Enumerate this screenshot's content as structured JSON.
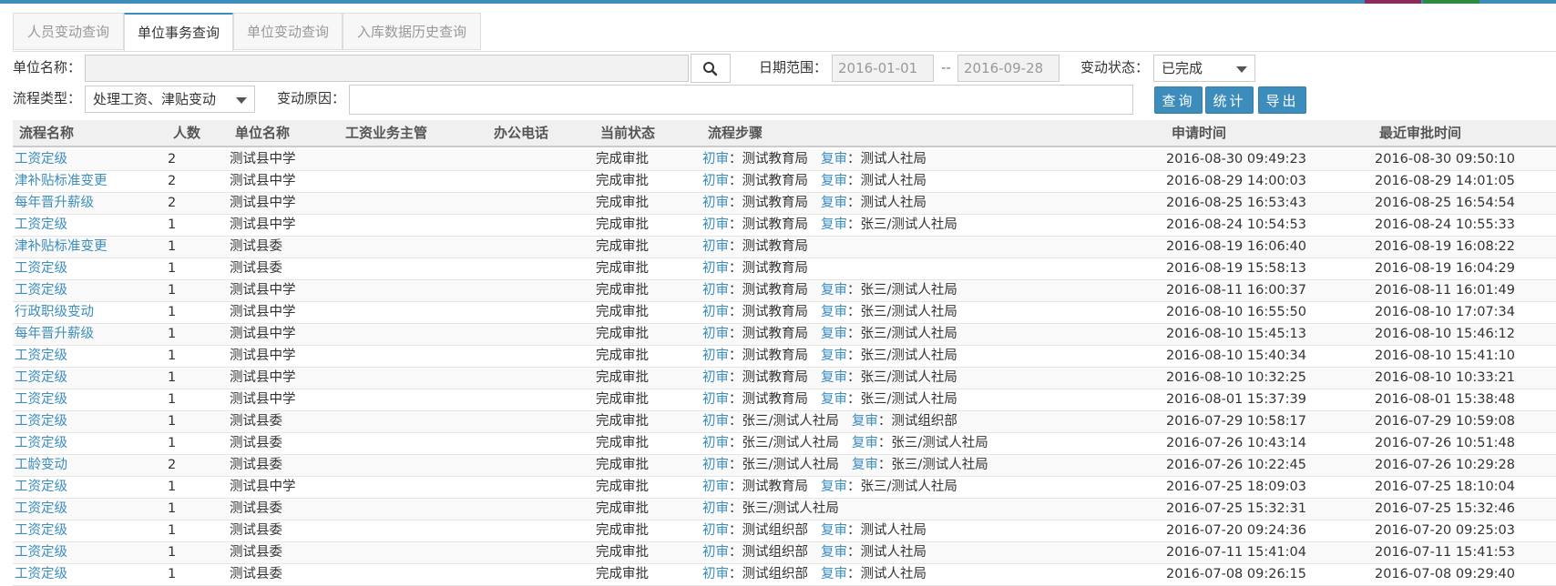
{
  "tabs": [
    "人员变动查询",
    "单位事务查询",
    "单位变动查询",
    "入库数据历史查询"
  ],
  "active_tab": 1,
  "filters": {
    "unit_name_label": "单位名称：",
    "unit_name_value": "",
    "date_range_label": "日期范围：",
    "date_from": "2016-01-01",
    "date_sep": "--",
    "date_to": "2016-09-28",
    "status_label": "变动状态：",
    "status_value": "已完成",
    "flow_type_label": "流程类型：",
    "flow_type_value": "处理工资、津贴变动",
    "reason_label": "变动原因：",
    "reason_value": ""
  },
  "buttons": {
    "query": "查询",
    "stats": "统计",
    "export": "导出"
  },
  "icons": {
    "search": "search-icon",
    "dropdown": "chevron-down-icon"
  },
  "colors": {
    "accent": "#3c8dbc",
    "topbar_segments": [
      "#3c8dbc",
      "#8e2b5d",
      "#2f8b3f"
    ]
  },
  "table": {
    "headers": [
      "流程名称",
      "人数",
      "单位名称",
      "工资业务主管",
      "办公电话",
      "当前状态",
      "流程步骤",
      "申请时间",
      "最近审批时间"
    ],
    "rows": [
      {
        "name": "工资定级",
        "count": "2",
        "unit": "测试县中学",
        "status": "完成审批",
        "step1_tag": "初审",
        "step1": "：测试教育局",
        "step2_tag": "复审",
        "step2": "：测试人社局",
        "apply": "2016-08-30 09:49:23",
        "approve": "2016-08-30 09:50:10"
      },
      {
        "name": "津补贴标准变更",
        "count": "2",
        "unit": "测试县中学",
        "status": "完成审批",
        "step1_tag": "初审",
        "step1": "：测试教育局",
        "step2_tag": "复审",
        "step2": "：测试人社局",
        "apply": "2016-08-29 14:00:03",
        "approve": "2016-08-29 14:01:05"
      },
      {
        "name": "每年晋升薪级",
        "count": "2",
        "unit": "测试县中学",
        "status": "完成审批",
        "step1_tag": "初审",
        "step1": "：测试教育局",
        "step2_tag": "复审",
        "step2": "：测试人社局",
        "apply": "2016-08-25 16:53:43",
        "approve": "2016-08-25 16:54:54"
      },
      {
        "name": "工资定级",
        "count": "1",
        "unit": "测试县中学",
        "status": "完成审批",
        "step1_tag": "初审",
        "step1": "：测试教育局",
        "step2_tag": "复审",
        "step2": "：张三/测试人社局",
        "apply": "2016-08-24 10:54:53",
        "approve": "2016-08-24 10:55:33"
      },
      {
        "name": "津补贴标准变更",
        "count": "1",
        "unit": "测试县委",
        "status": "完成审批",
        "step1_tag": "初审",
        "step1": "：测试教育局",
        "step2_tag": "",
        "step2": "",
        "apply": "2016-08-19 16:06:40",
        "approve": "2016-08-19 16:08:22"
      },
      {
        "name": "工资定级",
        "count": "1",
        "unit": "测试县委",
        "status": "完成审批",
        "step1_tag": "初审",
        "step1": "：测试教育局",
        "step2_tag": "",
        "step2": "",
        "apply": "2016-08-19 15:58:13",
        "approve": "2016-08-19 16:04:29"
      },
      {
        "name": "工资定级",
        "count": "1",
        "unit": "测试县中学",
        "status": "完成审批",
        "step1_tag": "初审",
        "step1": "：测试教育局",
        "step2_tag": "复审",
        "step2": "：张三/测试人社局",
        "apply": "2016-08-11 16:00:37",
        "approve": "2016-08-11 16:01:49"
      },
      {
        "name": "行政职级变动",
        "count": "1",
        "unit": "测试县中学",
        "status": "完成审批",
        "step1_tag": "初审",
        "step1": "：测试教育局",
        "step2_tag": "复审",
        "step2": "：张三/测试人社局",
        "apply": "2016-08-10 16:55:50",
        "approve": "2016-08-10 17:07:34"
      },
      {
        "name": "每年晋升薪级",
        "count": "1",
        "unit": "测试县中学",
        "status": "完成审批",
        "step1_tag": "初审",
        "step1": "：测试教育局",
        "step2_tag": "复审",
        "step2": "：张三/测试人社局",
        "apply": "2016-08-10 15:45:13",
        "approve": "2016-08-10 15:46:12"
      },
      {
        "name": "工资定级",
        "count": "1",
        "unit": "测试县中学",
        "status": "完成审批",
        "step1_tag": "初审",
        "step1": "：测试教育局",
        "step2_tag": "复审",
        "step2": "：张三/测试人社局",
        "apply": "2016-08-10 15:40:34",
        "approve": "2016-08-10 15:41:10"
      },
      {
        "name": "工资定级",
        "count": "1",
        "unit": "测试县中学",
        "status": "完成审批",
        "step1_tag": "初审",
        "step1": "：测试教育局",
        "step2_tag": "复审",
        "step2": "：张三/测试人社局",
        "apply": "2016-08-10 10:32:25",
        "approve": "2016-08-10 10:33:21"
      },
      {
        "name": "工资定级",
        "count": "1",
        "unit": "测试县中学",
        "status": "完成审批",
        "step1_tag": "初审",
        "step1": "：测试教育局",
        "step2_tag": "复审",
        "step2": "：张三/测试人社局",
        "apply": "2016-08-01 15:37:39",
        "approve": "2016-08-01 15:38:48"
      },
      {
        "name": "工资定级",
        "count": "1",
        "unit": "测试县委",
        "status": "完成审批",
        "step1_tag": "初审",
        "step1": "：张三/测试人社局",
        "step2_tag": "复审",
        "step2": "：测试组织部",
        "apply": "2016-07-29 10:58:17",
        "approve": "2016-07-29 10:59:08"
      },
      {
        "name": "工资定级",
        "count": "1",
        "unit": "测试县委",
        "status": "完成审批",
        "step1_tag": "初审",
        "step1": "：张三/测试人社局",
        "step2_tag": "复审",
        "step2": "：张三/测试人社局",
        "apply": "2016-07-26 10:43:14",
        "approve": "2016-07-26 10:51:48"
      },
      {
        "name": "工龄变动",
        "count": "2",
        "unit": "测试县委",
        "status": "完成审批",
        "step1_tag": "初审",
        "step1": "：张三/测试人社局",
        "step2_tag": "复审",
        "step2": "：张三/测试人社局",
        "apply": "2016-07-26 10:22:45",
        "approve": "2016-07-26 10:29:28"
      },
      {
        "name": "工资定级",
        "count": "1",
        "unit": "测试县中学",
        "status": "完成审批",
        "step1_tag": "初审",
        "step1": "：测试教育局",
        "step2_tag": "复审",
        "step2": "：张三/测试人社局",
        "apply": "2016-07-25 18:09:03",
        "approve": "2016-07-25 18:10:04"
      },
      {
        "name": "工资定级",
        "count": "1",
        "unit": "测试县委",
        "status": "完成审批",
        "step1_tag": "初审",
        "step1": "：张三/测试人社局",
        "step2_tag": "",
        "step2": "",
        "apply": "2016-07-25 15:32:31",
        "approve": "2016-07-25 15:32:46"
      },
      {
        "name": "工资定级",
        "count": "1",
        "unit": "测试县委",
        "status": "完成审批",
        "step1_tag": "初审",
        "step1": "：测试组织部",
        "step2_tag": "复审",
        "step2": "：测试人社局",
        "apply": "2016-07-20 09:24:36",
        "approve": "2016-07-20 09:25:03"
      },
      {
        "name": "工资定级",
        "count": "1",
        "unit": "测试县委",
        "status": "完成审批",
        "step1_tag": "初审",
        "step1": "：测试组织部",
        "step2_tag": "复审",
        "step2": "：测试人社局",
        "apply": "2016-07-11 15:41:04",
        "approve": "2016-07-11 15:41:53"
      },
      {
        "name": "工资定级",
        "count": "1",
        "unit": "测试县委",
        "status": "完成审批",
        "step1_tag": "初审",
        "step1": "：测试组织部",
        "step2_tag": "复审",
        "step2": "：测试人社局",
        "apply": "2016-07-08 09:26:15",
        "approve": "2016-07-08 09:29:40"
      }
    ]
  }
}
